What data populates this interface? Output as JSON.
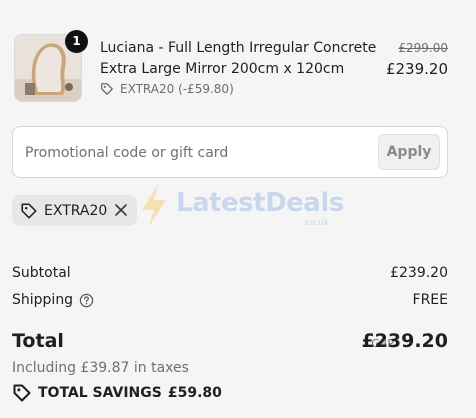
{
  "product": {
    "quantity": "1",
    "title": "Luciana - Full Length Irregular Concrete Extra Large Mirror 200cm x 120cm",
    "discount_text": "EXTRA20 (-£59.80)",
    "original_price": "£299.00",
    "price": "£239.20",
    "thumbnail_icon": "mirror-product-thumbnail"
  },
  "promo": {
    "placeholder": "Promotional code or gift card",
    "value": "",
    "apply_label": "Apply"
  },
  "applied_code": {
    "code": "EXTRA20",
    "tag_icon": "tag-icon",
    "remove_icon": "close-icon"
  },
  "watermark": {
    "text": "LatestDeals",
    "sub": ".co.uk"
  },
  "summary": {
    "subtotal_label": "Subtotal",
    "subtotal_value": "£239.20",
    "shipping_label": "Shipping",
    "shipping_value": "FREE",
    "total_label": "Total",
    "currency": "GBP",
    "total_value": "£239.20",
    "taxes_text": "Including £39.87 in taxes",
    "savings_label": "TOTAL SAVINGS",
    "savings_value": "£59.80"
  },
  "colors": {
    "background": "#f5f5f5",
    "text": "#1f1f1f",
    "muted": "#707070",
    "chip": "#e7e7e7"
  }
}
